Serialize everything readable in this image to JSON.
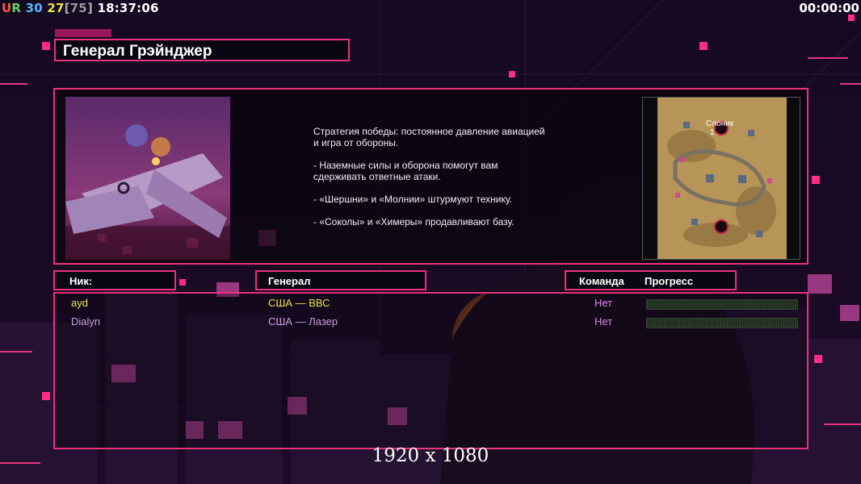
{
  "hud": {
    "ur_u": "U",
    "ur_r": "R",
    "fps": "30",
    "ping": "27",
    "max_open": "[",
    "max_value": "75",
    "max_close": "]",
    "clock": "18:37:06",
    "timer": "00:00:00"
  },
  "general": {
    "title": "Генерал Грэйнджер"
  },
  "description": {
    "lines": [
      "Стратегия победы: постоянное давление авиацией\n и игра от обороны.",
      "- Наземные силы и оборона помогут вам\n сдерживать ответные атаки.",
      "- «Шершни» и «Молнии» штурмуют технику.",
      "- «Соколы» и «Химеры» продавливают базу."
    ]
  },
  "minimap": {
    "map_name": "Слоник",
    "player_slot": "1"
  },
  "table": {
    "headers": {
      "nick": "Ник:",
      "general": "Генерал",
      "team": "Команда",
      "progress": "Прогресс"
    },
    "rows": [
      {
        "nick": "ayd",
        "general": "США — ВВС",
        "team": "Нет",
        "color": "#e8e24a",
        "team_color": "#d889e0"
      },
      {
        "nick": "Dialyn",
        "general": "США — Лазер",
        "team": "Нет",
        "color": "#c9a0dc",
        "team_color": "#d889e0"
      }
    ]
  },
  "footer": {
    "resolution": "1920 x 1080"
  },
  "colors": {
    "accent": "#e8327a",
    "background": "#0e0716"
  }
}
